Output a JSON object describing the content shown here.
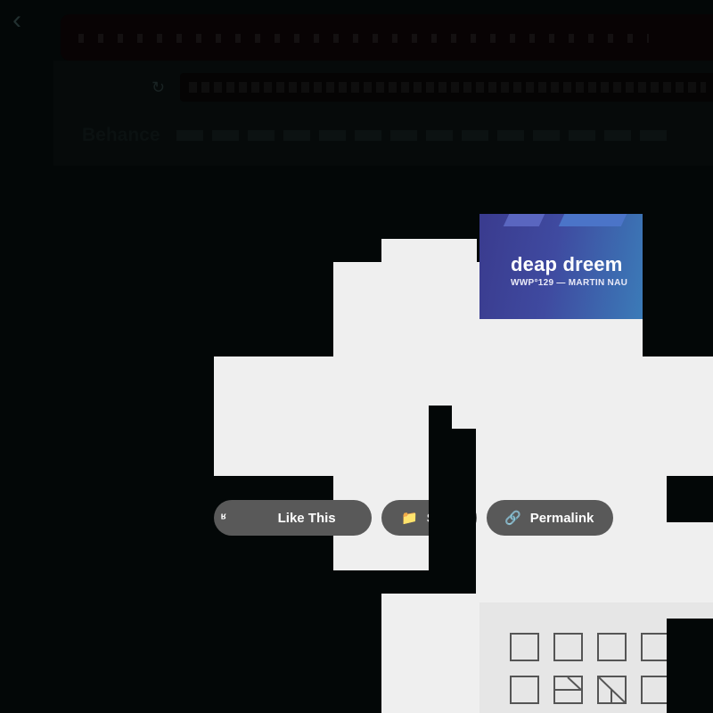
{
  "browser": {
    "back_icon": "arrow-left-icon",
    "reload_icon": "reload-icon",
    "site_name": "Behance"
  },
  "cover": {
    "title": "deap dreem",
    "subtitle": "WWP°129 — MARTIN NAU"
  },
  "actions": {
    "like_label": "Like This",
    "save_label": "Sa",
    "permalink_label": "Permalink",
    "like_icon": "thumbs-up-icon",
    "save_icon": "folder-icon",
    "permalink_icon": "link-icon"
  },
  "colors": {
    "pill_bg": "#595959",
    "cover_gradient_start": "#3a3b8e",
    "cover_gradient_end": "#3b7bb8"
  }
}
